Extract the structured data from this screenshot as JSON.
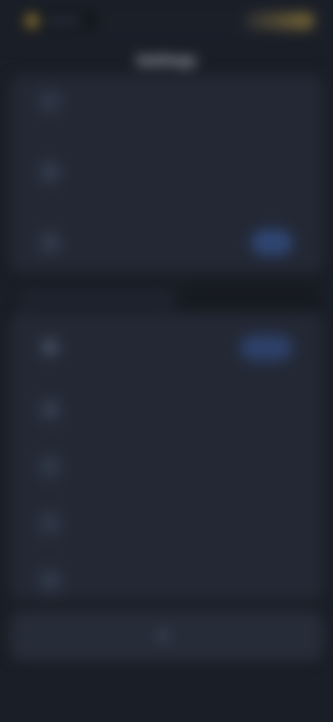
{
  "colors": {
    "background": "#1a1e26",
    "panel": "#232834",
    "accent": "#3a5ea8",
    "gold": "#b0913b"
  },
  "header": {
    "title": "Settings"
  },
  "top_card": {
    "rows": [
      {
        "icon": "info-icon",
        "label": "",
        "sub": ""
      },
      {
        "icon": "sliders-icon",
        "label": "",
        "sub": ""
      },
      {
        "icon": "link-icon",
        "label": "",
        "action": ""
      }
    ]
  },
  "section": {
    "title": ""
  },
  "second_card": {
    "rows": [
      {
        "icon": "user-icon",
        "label": "",
        "action": ""
      },
      {
        "icon": "bell-icon",
        "label": ""
      },
      {
        "icon": "shield-icon",
        "label": ""
      },
      {
        "icon": "help-icon",
        "label": ""
      },
      {
        "icon": "logout-icon",
        "label": ""
      }
    ]
  },
  "bottom": {
    "label": ""
  }
}
